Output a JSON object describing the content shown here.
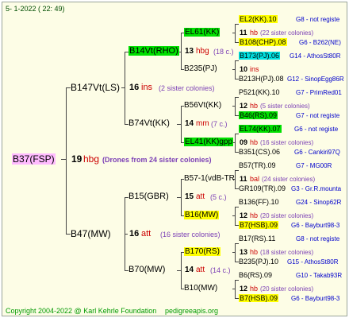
{
  "header": "5-  1-2022 ( 22: 49)",
  "footer": {
    "copyright": "Copyright 2004-2022 @ Karl Kehrle Foundation",
    "site": "pedigreeapis.org"
  },
  "colors": {
    "yellow": "#ffff00",
    "green": "#00e000",
    "cyan": "#00e0e0",
    "pink": "#ffbbff",
    "red": "#cc0000",
    "blue": "#0000cc",
    "purple": "#7b3fb5"
  },
  "root": {
    "name": "B37(FSP)",
    "num": "19",
    "abbr": "hbg",
    "note": "(Drones from 24 sister colonies)"
  },
  "gen1": [
    {
      "name": "B147Vt(LS)",
      "num": "16",
      "abbr": "ins",
      "note": "(2 sister colonies)"
    },
    {
      "name": "B47(MW)",
      "num": "16",
      "abbr": "att",
      "note": "(16 sister colonies)"
    }
  ],
  "gen2": [
    {
      "name": "B14Vt(RHO)",
      "num": "13",
      "abbr": "hbg",
      "note": "(18 c.)"
    },
    {
      "name": "B74Vt(KK)",
      "num": "14",
      "abbr": "mm",
      "note": "(7 c.)"
    },
    {
      "name": "B15(GBR)",
      "num": "15",
      "abbr": "att",
      "note": "(5 c.)"
    },
    {
      "name": "B70(MW)",
      "num": "14",
      "abbr": "att",
      "note": "(14 c.)"
    }
  ],
  "gen3": [
    {
      "name": "EL61(KK)",
      "num": "11",
      "abbr": "hb",
      "note": "(22 sister colonies)"
    },
    {
      "name": "B235(PJ)",
      "num": "10",
      "abbr": "ins",
      "note": ""
    },
    {
      "name": "B56Vt(KK)",
      "num": "12",
      "abbr": "hb",
      "note": "(5 sister colonies)"
    },
    {
      "name": "EL41(KK)gpp",
      "num": "09",
      "abbr": "hb",
      "note": "(16 sister colonies)"
    },
    {
      "name": "B57-1(vdB-TR",
      "num": "11",
      "abbr": "bal",
      "note": "(24 sister colonies)"
    },
    {
      "name": "B16(MW)",
      "num": "12",
      "abbr": "hb",
      "note": "(20 sister colonies)"
    },
    {
      "name": "B170(RS)",
      "num": "13",
      "abbr": "hb",
      "note": "(18 sister colonies)"
    },
    {
      "name": "B10(MW)",
      "num": "12",
      "abbr": "hb",
      "note": "(20 sister colonies)"
    }
  ],
  "gen4": [
    {
      "name": "EL2(KK).10",
      "src": "G8 - not registe"
    },
    {
      "name": "B108(CHP).08",
      "src": "G6 - B262(NE)"
    },
    {
      "name": "B173(PJ).06",
      "src": "G14 - AthosSt80R"
    },
    {
      "name": "B213H(PJ).08",
      "src": "G12 - SinopEgg86R"
    },
    {
      "name": "P521(KK).10",
      "src": "G7 - PrimRed01"
    },
    {
      "name": "B46(RS).09",
      "src": "G7 - not registe"
    },
    {
      "name": "EL74(KK).07",
      "src": "G6 - not registe"
    },
    {
      "name": "B351(CS).06",
      "src": "G6 - Cankiri97Q"
    },
    {
      "name": "B57(TR).09",
      "src": "G7 - MG00R"
    },
    {
      "name": "GR109(TR).09",
      "src": "G3 - Gr.R.mounta"
    },
    {
      "name": "B136(FF).10",
      "src": "G24 - Sinop62R"
    },
    {
      "name": "B7(HSB).09",
      "src": "G6 - Bayburt98-3"
    },
    {
      "name": "B17(RS).11",
      "src": "G8 - not registe"
    },
    {
      "name": "B235(PJ).10",
      "src": "G15 - AthosSt80R"
    },
    {
      "name": "B6(RS).09",
      "src": "G10 - Takab93R"
    },
    {
      "name": "B7(HSB).09",
      "src": "G6 - Bayburt98-3"
    }
  ]
}
